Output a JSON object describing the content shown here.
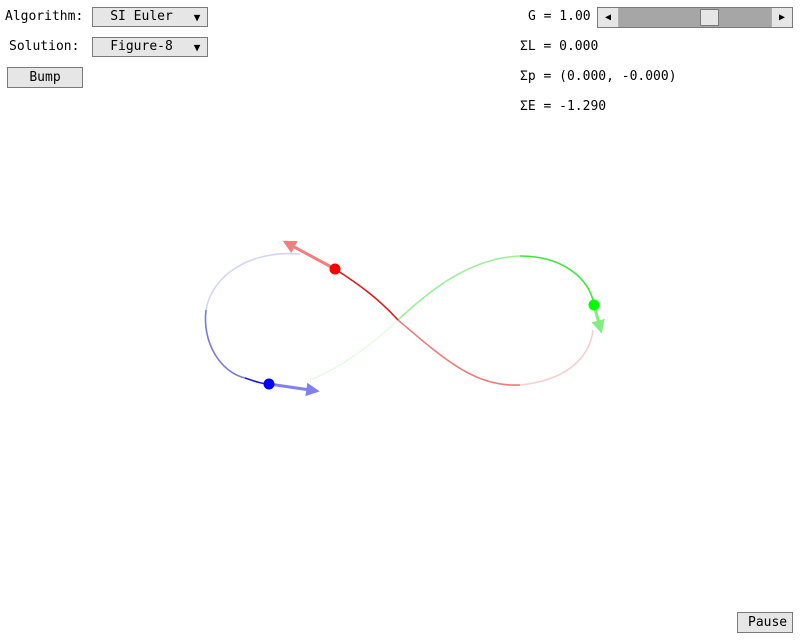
{
  "controls": {
    "algorithm_label": "Algorithm:",
    "algorithm_value": "SI Euler",
    "solution_label": "Solution:",
    "solution_value": "Figure-8",
    "bump_label": "Bump",
    "pause_label": "Pause"
  },
  "gravity": {
    "label": "G = 1.00",
    "value": 1.0,
    "slider_fraction": 0.5,
    "left_arrow_icon": "triangle-left-icon",
    "right_arrow_icon": "triangle-right-icon"
  },
  "stats": {
    "angular_momentum": "ΣL = 0.000",
    "momentum": "Σp = (0.000, -0.000)",
    "energy": "ΣE = -1.290"
  },
  "icons": {
    "dropdown_arrow": "triangle-down-icon"
  },
  "colors": {
    "body_red": "#ff0000",
    "body_green": "#00ff00",
    "body_blue": "#0000ff",
    "velocity_red": "#f08080",
    "velocity_green": "#80ee80",
    "velocity_blue": "#8080f0",
    "control_bg": "#e6e6e6",
    "slider_track": "#a6a6a6"
  }
}
